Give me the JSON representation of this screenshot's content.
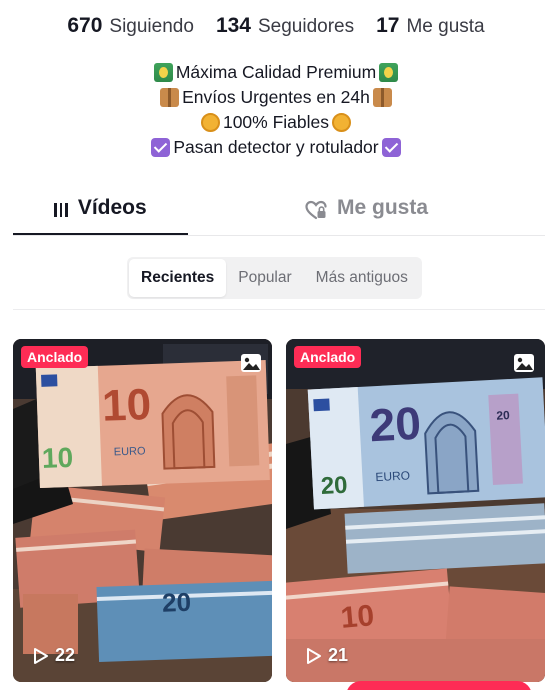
{
  "stats": [
    {
      "value": "670",
      "label": "Siguiendo"
    },
    {
      "value": "134",
      "label": "Seguidores"
    },
    {
      "value": "17",
      "label": "Me gusta"
    }
  ],
  "bio": [
    {
      "text": "Máxima Calidad Premium",
      "icon": "money-bag-emoji"
    },
    {
      "text": "Envíos Urgentes en 24h",
      "icon": "package-emoji"
    },
    {
      "text": "100% Fiables",
      "icon": "coin-emoji"
    },
    {
      "text": "Pasan detector y rotulador",
      "icon": "check-box-emoji"
    }
  ],
  "tabs": {
    "videos": "Vídeos",
    "likes": "Me gusta"
  },
  "filters": [
    "Recientes",
    "Popular",
    "Más antiguos"
  ],
  "active_filter": "Recientes",
  "cards": [
    {
      "badge": "Anclado",
      "views": "22"
    },
    {
      "badge": "Anclado",
      "views": "21"
    }
  ],
  "colors": {
    "accent": "#fe2c55",
    "text": "#161823",
    "muted": "#8a8b91"
  }
}
